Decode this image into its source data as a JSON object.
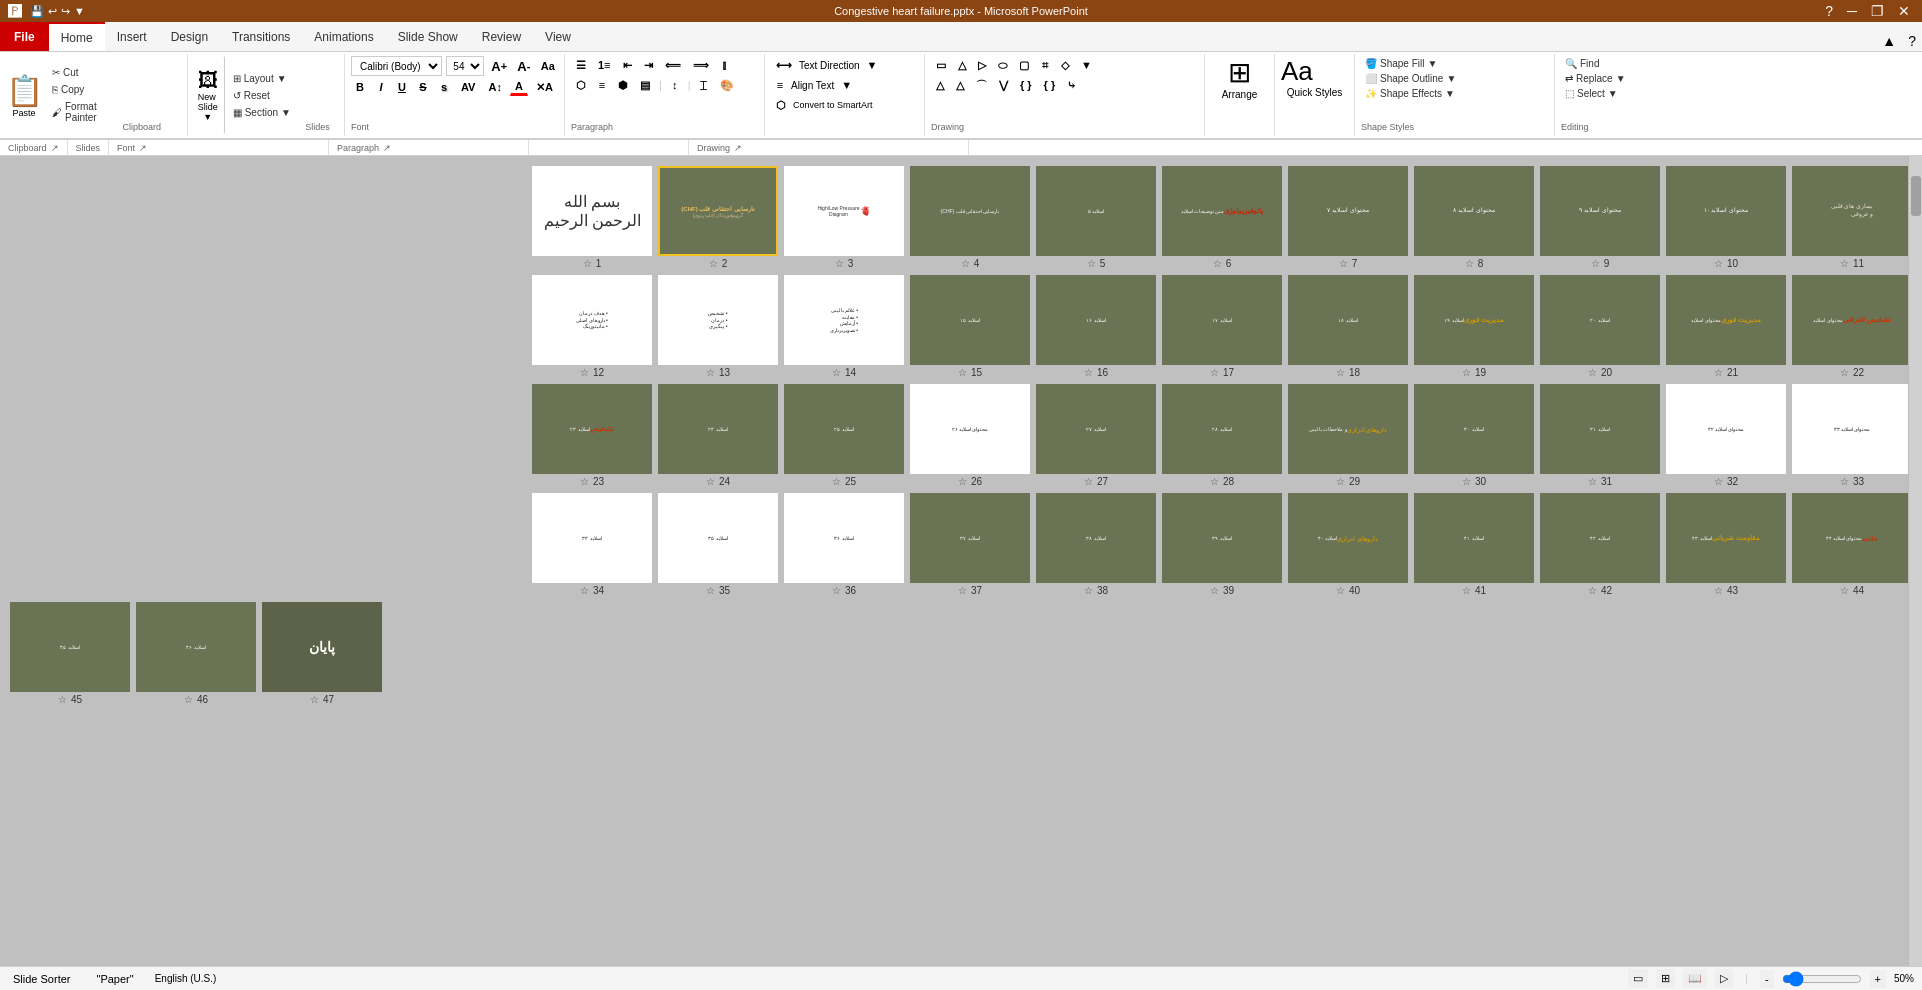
{
  "titleBar": {
    "quickAccess": [
      "save",
      "undo",
      "redo",
      "customize"
    ],
    "title": "Congestive heart failure.pptx - Microsoft PowerPoint",
    "controls": [
      "minimize",
      "restore",
      "close"
    ],
    "helpIcon": "?"
  },
  "tabs": [
    {
      "id": "file",
      "label": "File",
      "isFile": true
    },
    {
      "id": "home",
      "label": "Home",
      "active": true
    },
    {
      "id": "insert",
      "label": "Insert"
    },
    {
      "id": "design",
      "label": "Design"
    },
    {
      "id": "transitions",
      "label": "Transitions"
    },
    {
      "id": "animations",
      "label": "Animations"
    },
    {
      "id": "slideshow",
      "label": "Slide Show"
    },
    {
      "id": "review",
      "label": "Review"
    },
    {
      "id": "view",
      "label": "View"
    }
  ],
  "ribbon": {
    "clipboard": {
      "label": "Clipboard",
      "paste": "Paste",
      "cut": "Cut",
      "copy": "Copy",
      "formatPainter": "Format Painter"
    },
    "slides": {
      "label": "Slides",
      "newSlide": "New Slide",
      "layout": "Layout",
      "reset": "Reset",
      "section": "Section"
    },
    "font": {
      "label": "Font",
      "fontName": "Calibri (Body)",
      "fontSize": "54",
      "bold": "B",
      "italic": "I",
      "underline": "U",
      "strikethrough": "S",
      "shadow": "S",
      "increaseFont": "A↑",
      "decreaseFont": "A↓",
      "changeCase": "Aa",
      "fontColor": "A"
    },
    "paragraph": {
      "label": "Paragraph"
    },
    "drawing": {
      "label": "Drawing"
    },
    "textDirection": {
      "label": "Text Direction",
      "alignText": "Align Text",
      "convertSmartArt": "Convert to SmartArt"
    },
    "arrange": {
      "label": "Arrange"
    },
    "quickStyles": {
      "label": "Quick Styles"
    },
    "shapeOptions": {
      "shapeFill": "Shape Fill",
      "shapeOutline": "Shape Outline",
      "shapeEffects": "Shape Effects"
    },
    "editing": {
      "label": "Editing",
      "find": "Find",
      "replace": "Replace",
      "select": "Select"
    }
  },
  "slides": [
    {
      "num": 1,
      "type": "dark",
      "hasArabic": true
    },
    {
      "num": 2,
      "type": "dark",
      "selected": true,
      "titleText": "نارسایی احتقانی قلب (CHF)",
      "subtitleText": "گرویوفورنتال (قلبـ-ریوی)"
    },
    {
      "num": 3,
      "type": "diagram",
      "hasDiagram": true
    },
    {
      "num": 4,
      "type": "dark"
    },
    {
      "num": 5,
      "type": "dark"
    },
    {
      "num": 6,
      "type": "dark"
    },
    {
      "num": 7,
      "type": "dark"
    },
    {
      "num": 8,
      "type": "dark"
    },
    {
      "num": 9,
      "type": "dark"
    },
    {
      "num": 10,
      "type": "dark"
    },
    {
      "num": 11,
      "type": "dark"
    },
    {
      "num": 12,
      "type": "white"
    },
    {
      "num": 13,
      "type": "white"
    },
    {
      "num": 14,
      "type": "white"
    },
    {
      "num": 15,
      "type": "dark"
    },
    {
      "num": 16,
      "type": "dark"
    },
    {
      "num": 17,
      "type": "dark"
    },
    {
      "num": 18,
      "type": "dark"
    },
    {
      "num": 19,
      "type": "dark"
    },
    {
      "num": 20,
      "type": "dark"
    },
    {
      "num": 21,
      "type": "dark"
    },
    {
      "num": 22,
      "type": "dark"
    },
    {
      "num": 23,
      "type": "dark"
    },
    {
      "num": 24,
      "type": "dark"
    },
    {
      "num": 25,
      "type": "dark"
    },
    {
      "num": 26,
      "type": "white"
    },
    {
      "num": 27,
      "type": "dark"
    },
    {
      "num": 28,
      "type": "dark"
    },
    {
      "num": 29,
      "type": "dark"
    },
    {
      "num": 30,
      "type": "dark"
    },
    {
      "num": 31,
      "type": "dark"
    },
    {
      "num": 32,
      "type": "white"
    },
    {
      "num": 33,
      "type": "white"
    },
    {
      "num": 34,
      "type": "white"
    },
    {
      "num": 35,
      "type": "white"
    },
    {
      "num": 36,
      "type": "white"
    },
    {
      "num": 37,
      "type": "dark"
    },
    {
      "num": 38,
      "type": "dark"
    },
    {
      "num": 39,
      "type": "dark"
    },
    {
      "num": 40,
      "type": "dark"
    },
    {
      "num": 41,
      "type": "dark"
    },
    {
      "num": 42,
      "type": "dark"
    },
    {
      "num": 43,
      "type": "dark"
    },
    {
      "num": 44,
      "type": "dark"
    },
    {
      "num": 45,
      "type": "dark"
    },
    {
      "num": 46,
      "type": "dark"
    },
    {
      "num": 47,
      "type": "special",
      "titleText": "پایان"
    }
  ],
  "statusBar": {
    "view": "Slide Sorter",
    "tab": "\"Paper\"",
    "language": "English (U.S.)",
    "zoom": "50%",
    "zoomLevel": 50
  }
}
